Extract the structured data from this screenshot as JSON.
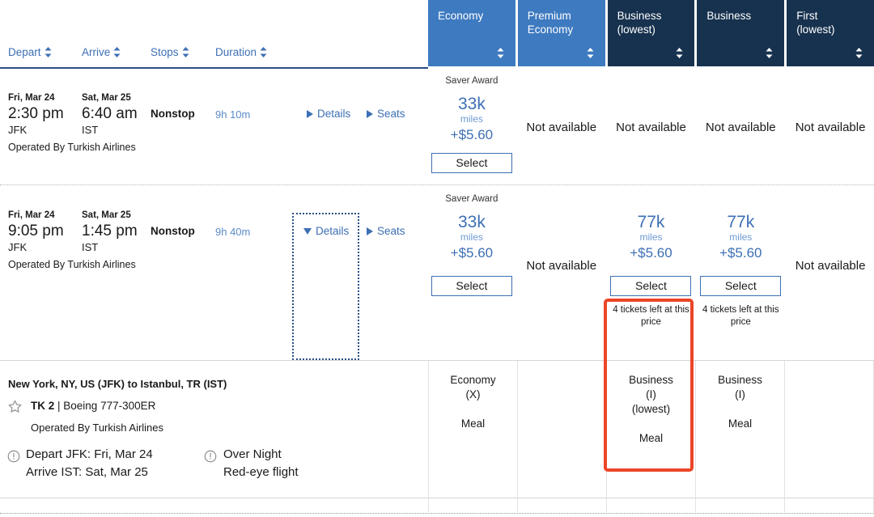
{
  "sort_headers": [
    {
      "label": "Depart",
      "icon": "sort-updown-icon"
    },
    {
      "label": "Arrive",
      "icon": "sort-updown-icon"
    },
    {
      "label": "Stops",
      "icon": "sort-updown-icon"
    },
    {
      "label": "Duration",
      "icon": "sort-updown-icon"
    }
  ],
  "cabin_tabs": [
    {
      "line1": "Economy",
      "line2": "",
      "style": "light"
    },
    {
      "line1": "Premium",
      "line2": "Economy",
      "style": "light"
    },
    {
      "line1": "Business",
      "line2": "(lowest)",
      "style": "dark"
    },
    {
      "line1": "Business",
      "line2": "",
      "style": "dark"
    },
    {
      "line1": "First",
      "line2": "(lowest)",
      "style": "dark"
    }
  ],
  "colors": {
    "tab_light": "#3e7ac0",
    "tab_dark": "#17324f",
    "link_blue": "#3d6fb4",
    "highlight_red": "#ec4527"
  },
  "flights": [
    {
      "depart_date": "Fri, Mar 24",
      "depart_time": "2:30 pm",
      "depart_airport": "JFK",
      "arrive_date": "Sat, Mar 25",
      "arrive_time": "6:40 am",
      "arrive_airport": "IST",
      "stops": "Nonstop",
      "duration": "9h 10m",
      "operated_by": "Operated By Turkish Airlines",
      "details_label": "Details",
      "seats_label": "Seats",
      "details_expanded": false,
      "fares": [
        {
          "award_label": "Saver Award",
          "miles": "33k",
          "miles_word": "miles",
          "cash": "+$5.60",
          "button": "Select",
          "tickets_left": "",
          "available": true
        },
        {
          "unavailable_label": "Not available",
          "available": false
        },
        {
          "unavailable_label": "Not available",
          "available": false
        },
        {
          "unavailable_label": "Not available",
          "available": false
        },
        {
          "unavailable_label": "Not available",
          "available": false
        }
      ]
    },
    {
      "depart_date": "Fri, Mar 24",
      "depart_time": "9:05 pm",
      "depart_airport": "JFK",
      "arrive_date": "Sat, Mar 25",
      "arrive_time": "1:45 pm",
      "arrive_airport": "IST",
      "stops": "Nonstop",
      "duration": "9h 40m",
      "operated_by": "Operated By Turkish Airlines",
      "details_label": "Details",
      "seats_label": "Seats",
      "details_expanded": true,
      "fares": [
        {
          "award_label": "Saver Award",
          "miles": "33k",
          "miles_word": "miles",
          "cash": "+$5.60",
          "button": "Select",
          "tickets_left": "",
          "available": true
        },
        {
          "unavailable_label": "Not available",
          "available": false
        },
        {
          "award_label": "",
          "miles": "77k",
          "miles_word": "miles",
          "cash": "+$5.60",
          "button": "Select",
          "tickets_left": "4 tickets left at this price",
          "available": true
        },
        {
          "award_label": "",
          "miles": "77k",
          "miles_word": "miles",
          "cash": "+$5.60",
          "button": "Select",
          "tickets_left": "4 tickets left at this price",
          "available": true
        },
        {
          "unavailable_label": "Not available",
          "available": false
        }
      ]
    }
  ],
  "details_panel": {
    "route": "New York, NY, US (JFK) to Istanbul, TR (IST)",
    "star_icon": "star-icon",
    "flight_number": "TK 2",
    "separator": "|",
    "aircraft": "Boeing 777-300ER",
    "operated_by": "Operated By Turkish Airlines",
    "notes": [
      {
        "icon": "exclamation-circle-icon",
        "line1": "Depart JFK: Fri, Mar 24",
        "line2": "Arrive IST: Sat, Mar 25"
      },
      {
        "icon": "exclamation-circle-icon",
        "line1": "Over Night",
        "line2": "Red-eye flight"
      }
    ],
    "cabins": [
      {
        "line1": "Economy",
        "line2": "(X)",
        "line3": "",
        "meal": "Meal"
      },
      {
        "line1": "",
        "line2": "",
        "line3": "",
        "meal": ""
      },
      {
        "line1": "Business",
        "line2": "(I)",
        "line3": "(lowest)",
        "meal": "Meal"
      },
      {
        "line1": "Business",
        "line2": "(I)",
        "line3": "",
        "meal": "Meal"
      },
      {
        "line1": "",
        "line2": "",
        "line3": "",
        "meal": ""
      }
    ]
  }
}
